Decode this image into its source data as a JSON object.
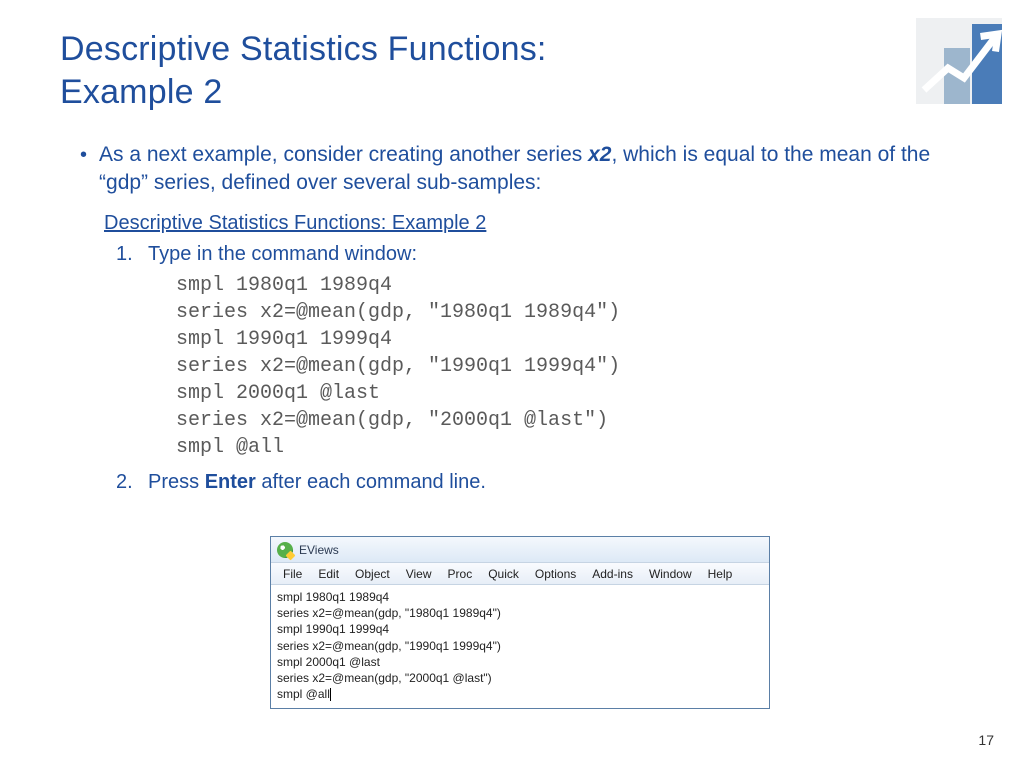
{
  "title_line1": "Descriptive Statistics Functions:",
  "title_line2": "Example 2",
  "bullet": {
    "pre": "As a next example, consider creating another series ",
    "var": "x2",
    "post": ", which is equal to the mean of the “gdp” series, defined over several sub-samples:"
  },
  "sub_heading": "Descriptive Statistics Functions: Example 2",
  "steps": {
    "s1_num": "1.",
    "s1_text": "Type in the command window:",
    "s2_num": "2.",
    "s2_pre": "Press ",
    "s2_key": "Enter",
    "s2_post": " after each command line."
  },
  "code_lines": "smpl 1980q1 1989q4\nseries x2=@mean(gdp, \"1980q1 1989q4\")\nsmpl 1990q1 1999q4\nseries x2=@mean(gdp, \"1990q1 1999q4\")\nsmpl 2000q1 @last\nseries x2=@mean(gdp, \"2000q1 @last\")\nsmpl @all",
  "app": {
    "title": "EViews",
    "menu": [
      "File",
      "Edit",
      "Object",
      "View",
      "Proc",
      "Quick",
      "Options",
      "Add-ins",
      "Window",
      "Help"
    ],
    "content": "smpl 1980q1 1989q4\nseries x2=@mean(gdp, \"1980q1 1989q4\")\nsmpl 1990q1 1999q4\nseries x2=@mean(gdp, \"1990q1 1999q4\")\nsmpl 2000q1 @last\nseries x2=@mean(gdp, \"2000q1 @last\")\nsmpl @all"
  },
  "page_number": "17"
}
